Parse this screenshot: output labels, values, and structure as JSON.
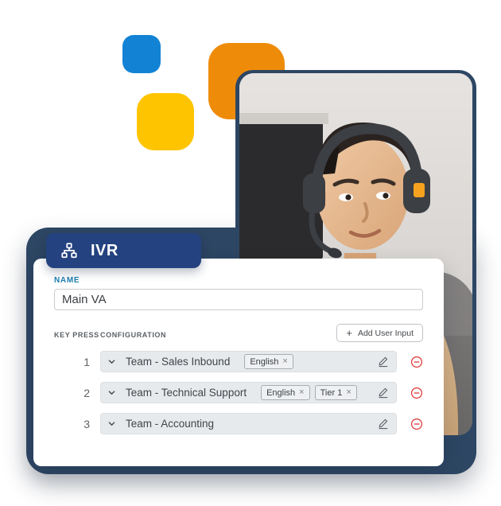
{
  "card": {
    "tab": {
      "label": "IVR",
      "icon": "sitemap-icon",
      "color": "#24427f"
    },
    "name_field": {
      "label": "NAME",
      "value": "Main VA",
      "placeholder": "Enter name",
      "label_color": "#1e7fb0"
    },
    "table": {
      "columns": {
        "key_press": "KEY PRESS",
        "configuration": "CONFIGURATION"
      },
      "add_button": {
        "label": "Add User Input",
        "icon": "plus-icon"
      },
      "rows": [
        {
          "key": "1",
          "title": "Team - Sales Inbound",
          "chips": [
            "English"
          ],
          "edit_icon": "pencil-icon",
          "remove_icon": "minus-circle-icon"
        },
        {
          "key": "2",
          "title": "Team - Technical Support",
          "chips": [
            "English",
            "Tier 1"
          ],
          "edit_icon": "pencil-icon",
          "remove_icon": "minus-circle-icon"
        },
        {
          "key": "3",
          "title": "Team - Accounting",
          "chips": [],
          "edit_icon": "pencil-icon",
          "remove_icon": "minus-circle-icon"
        }
      ],
      "chip_remove_glyph": "×"
    }
  },
  "decorations": {
    "blue_square": "#1283d4",
    "yellow_square": "#ffc400",
    "orange_square": "#ee8c0a",
    "device_frame": "#2d4663"
  },
  "photo": {
    "alt": "Customer support agent wearing a headset at a desk"
  }
}
